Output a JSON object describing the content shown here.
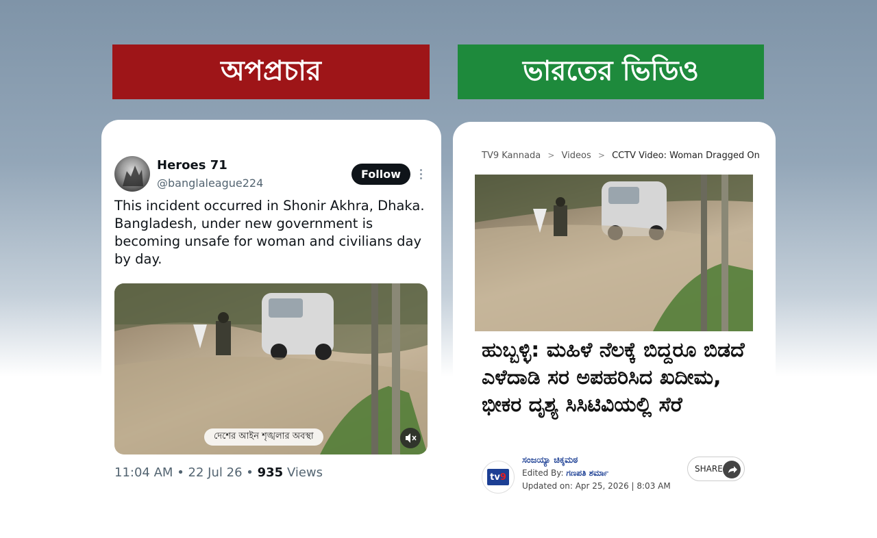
{
  "banners": {
    "left": "অপপ্রচার",
    "right": "ভারতের ভিডিও"
  },
  "tweet": {
    "author_name": "Heroes 71",
    "author_handle": "@banglaleague224",
    "follow_label": "Follow",
    "text": "This incident occurred in Shonir Akhra, Dhaka. Bangladesh, under new government is becoming unsafe for woman and civilians day by day.",
    "media_caption": "দেশের আইন শৃঙ্খলার অবস্থা",
    "time": "11:04 AM",
    "date": "22 Jul 26",
    "views_count": "935",
    "views_label": "Views",
    "separator": "•"
  },
  "article": {
    "breadcrumb": [
      "TV9 Kannada",
      "Videos",
      "CCTV Video: Woman Dragged On"
    ],
    "breadcrumb_sep": ">",
    "headline": "ಹುಬ್ಬಳ್ಳಿ: ಮಹಿಳೆ ನೆಲಕ್ಕೆ ಬಿದ್ದರೂ ಬಿಡದೆ ಎಳೆದಾಡಿ ಸರ ಅಪಹರಿಸಿದ ಖದೀಮ, ಭೀಕರ ದೃಶ್ಯ ಸಿಸಿಟಿವಿಯಲ್ಲಿ ಸೆರೆ",
    "logo_text_1": "tv",
    "logo_text_2": "9",
    "author": "ಸಂಜಯ್ಯಾ ಚಿಕ್ಕಮಠ",
    "edited_prefix": "Edited By:",
    "edited_by": "ಗಣಪತಿ ಶರ್ಮಾ",
    "updated": "Updated on: Apr 25, 2026 | 8:03 AM",
    "share_label": "SHARE"
  },
  "colors": {
    "banner_red": "#9e1518",
    "banner_green": "#1e8a3c",
    "tv9_blue": "#1c3f94"
  }
}
